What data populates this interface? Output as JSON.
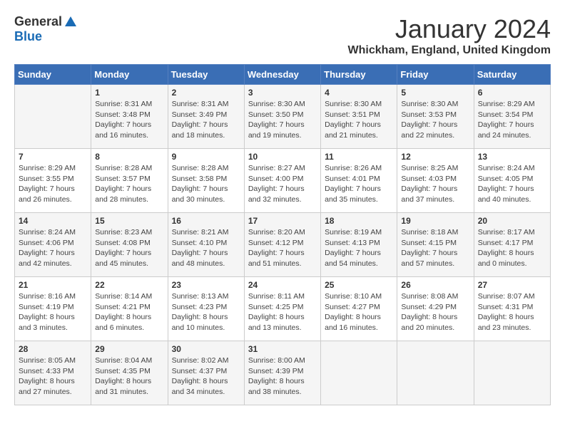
{
  "header": {
    "logo_general": "General",
    "logo_blue": "Blue",
    "month_year": "January 2024",
    "location": "Whickham, England, United Kingdom"
  },
  "days_of_week": [
    "Sunday",
    "Monday",
    "Tuesday",
    "Wednesday",
    "Thursday",
    "Friday",
    "Saturday"
  ],
  "weeks": [
    [
      {
        "day": "",
        "content": ""
      },
      {
        "day": "1",
        "content": "Sunrise: 8:31 AM\nSunset: 3:48 PM\nDaylight: 7 hours\nand 16 minutes."
      },
      {
        "day": "2",
        "content": "Sunrise: 8:31 AM\nSunset: 3:49 PM\nDaylight: 7 hours\nand 18 minutes."
      },
      {
        "day": "3",
        "content": "Sunrise: 8:30 AM\nSunset: 3:50 PM\nDaylight: 7 hours\nand 19 minutes."
      },
      {
        "day": "4",
        "content": "Sunrise: 8:30 AM\nSunset: 3:51 PM\nDaylight: 7 hours\nand 21 minutes."
      },
      {
        "day": "5",
        "content": "Sunrise: 8:30 AM\nSunset: 3:53 PM\nDaylight: 7 hours\nand 22 minutes."
      },
      {
        "day": "6",
        "content": "Sunrise: 8:29 AM\nSunset: 3:54 PM\nDaylight: 7 hours\nand 24 minutes."
      }
    ],
    [
      {
        "day": "7",
        "content": "Sunrise: 8:29 AM\nSunset: 3:55 PM\nDaylight: 7 hours\nand 26 minutes."
      },
      {
        "day": "8",
        "content": "Sunrise: 8:28 AM\nSunset: 3:57 PM\nDaylight: 7 hours\nand 28 minutes."
      },
      {
        "day": "9",
        "content": "Sunrise: 8:28 AM\nSunset: 3:58 PM\nDaylight: 7 hours\nand 30 minutes."
      },
      {
        "day": "10",
        "content": "Sunrise: 8:27 AM\nSunset: 4:00 PM\nDaylight: 7 hours\nand 32 minutes."
      },
      {
        "day": "11",
        "content": "Sunrise: 8:26 AM\nSunset: 4:01 PM\nDaylight: 7 hours\nand 35 minutes."
      },
      {
        "day": "12",
        "content": "Sunrise: 8:25 AM\nSunset: 4:03 PM\nDaylight: 7 hours\nand 37 minutes."
      },
      {
        "day": "13",
        "content": "Sunrise: 8:24 AM\nSunset: 4:05 PM\nDaylight: 7 hours\nand 40 minutes."
      }
    ],
    [
      {
        "day": "14",
        "content": "Sunrise: 8:24 AM\nSunset: 4:06 PM\nDaylight: 7 hours\nand 42 minutes."
      },
      {
        "day": "15",
        "content": "Sunrise: 8:23 AM\nSunset: 4:08 PM\nDaylight: 7 hours\nand 45 minutes."
      },
      {
        "day": "16",
        "content": "Sunrise: 8:21 AM\nSunset: 4:10 PM\nDaylight: 7 hours\nand 48 minutes."
      },
      {
        "day": "17",
        "content": "Sunrise: 8:20 AM\nSunset: 4:12 PM\nDaylight: 7 hours\nand 51 minutes."
      },
      {
        "day": "18",
        "content": "Sunrise: 8:19 AM\nSunset: 4:13 PM\nDaylight: 7 hours\nand 54 minutes."
      },
      {
        "day": "19",
        "content": "Sunrise: 8:18 AM\nSunset: 4:15 PM\nDaylight: 7 hours\nand 57 minutes."
      },
      {
        "day": "20",
        "content": "Sunrise: 8:17 AM\nSunset: 4:17 PM\nDaylight: 8 hours\nand 0 minutes."
      }
    ],
    [
      {
        "day": "21",
        "content": "Sunrise: 8:16 AM\nSunset: 4:19 PM\nDaylight: 8 hours\nand 3 minutes."
      },
      {
        "day": "22",
        "content": "Sunrise: 8:14 AM\nSunset: 4:21 PM\nDaylight: 8 hours\nand 6 minutes."
      },
      {
        "day": "23",
        "content": "Sunrise: 8:13 AM\nSunset: 4:23 PM\nDaylight: 8 hours\nand 10 minutes."
      },
      {
        "day": "24",
        "content": "Sunrise: 8:11 AM\nSunset: 4:25 PM\nDaylight: 8 hours\nand 13 minutes."
      },
      {
        "day": "25",
        "content": "Sunrise: 8:10 AM\nSunset: 4:27 PM\nDaylight: 8 hours\nand 16 minutes."
      },
      {
        "day": "26",
        "content": "Sunrise: 8:08 AM\nSunset: 4:29 PM\nDaylight: 8 hours\nand 20 minutes."
      },
      {
        "day": "27",
        "content": "Sunrise: 8:07 AM\nSunset: 4:31 PM\nDaylight: 8 hours\nand 23 minutes."
      }
    ],
    [
      {
        "day": "28",
        "content": "Sunrise: 8:05 AM\nSunset: 4:33 PM\nDaylight: 8 hours\nand 27 minutes."
      },
      {
        "day": "29",
        "content": "Sunrise: 8:04 AM\nSunset: 4:35 PM\nDaylight: 8 hours\nand 31 minutes."
      },
      {
        "day": "30",
        "content": "Sunrise: 8:02 AM\nSunset: 4:37 PM\nDaylight: 8 hours\nand 34 minutes."
      },
      {
        "day": "31",
        "content": "Sunrise: 8:00 AM\nSunset: 4:39 PM\nDaylight: 8 hours\nand 38 minutes."
      },
      {
        "day": "",
        "content": ""
      },
      {
        "day": "",
        "content": ""
      },
      {
        "day": "",
        "content": ""
      }
    ]
  ]
}
